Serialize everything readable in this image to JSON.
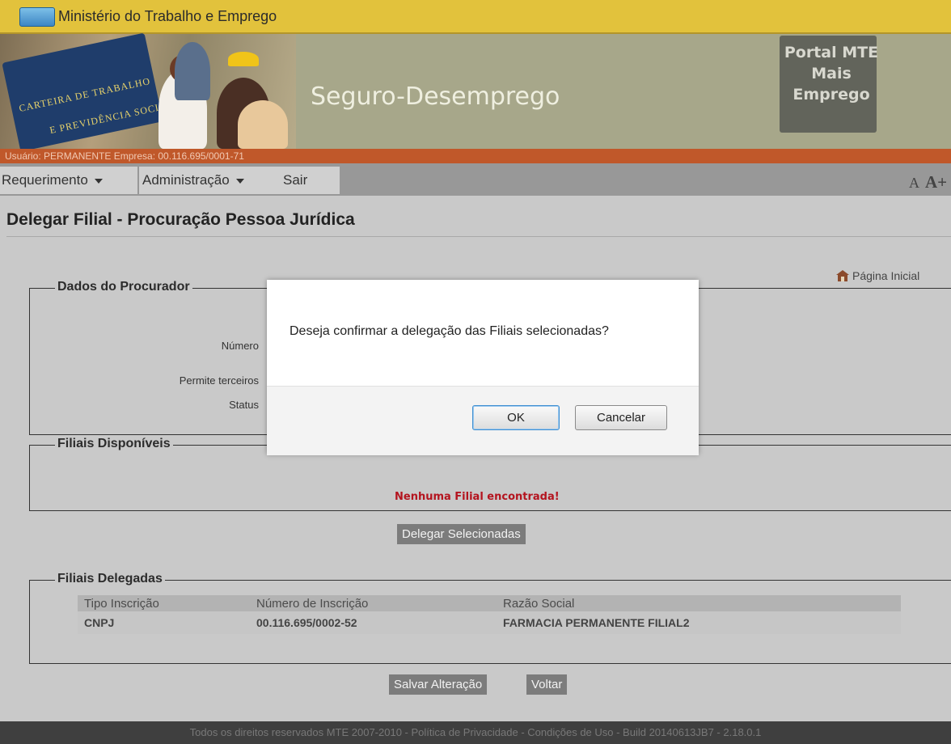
{
  "gov_bar": {
    "title": "Ministério do Trabalho e Emprego"
  },
  "header": {
    "card_line1": "CARTEIRA DE TRABALHO",
    "card_line2": "E PREVIDÊNCIA SOCIAL",
    "site_title": "Seguro-Desemprego",
    "portal_line1": "Portal MTE",
    "portal_line2": "Mais",
    "portal_line3": "Emprego"
  },
  "user_bar": {
    "text": "Usuário: PERMANENTE Empresa: 00.116.695/0001-71"
  },
  "menu": {
    "items": [
      {
        "label": "Requerimento",
        "has_dropdown": true
      },
      {
        "label": "Administração",
        "has_dropdown": true
      },
      {
        "label": "Sair",
        "has_dropdown": false
      }
    ],
    "font_small": "A",
    "font_large": "A+"
  },
  "page": {
    "title": "Delegar Filial - Procuração Pessoa Jurídica",
    "home_link": "Página Inicial"
  },
  "procurador": {
    "legend": "Dados do Procurador",
    "label_numero": "Número",
    "label_permite": "Permite terceiros",
    "label_status": "Status"
  },
  "disponiveis": {
    "legend": "Filiais Disponíveis",
    "empty_message": "Nenhuma Filial encontrada!",
    "delegate_button": "Delegar Selecionadas"
  },
  "delegadas": {
    "legend": "Filiais Delegadas",
    "columns": [
      "Tipo Inscrição",
      "Número de Inscrição",
      "Razão Social"
    ],
    "rows": [
      {
        "tipo": "CNPJ",
        "numero": "00.116.695/0002-52",
        "razao": "FARMACIA PERMANENTE FILIAL2"
      }
    ]
  },
  "actions": {
    "save": "Salvar Alteração",
    "back": "Voltar"
  },
  "footer": {
    "text": "Todos os direitos reservados MTE 2007-2010 - Política de Privacidade - Condições de Uso - Build 20140613JB7 - 2.18.0.1"
  },
  "dialog": {
    "message": "Deseja confirmar a delegação das Filiais selecionadas?",
    "ok": "OK",
    "cancel": "Cancelar"
  },
  "colors": {
    "gov_bar": "#e2c23c",
    "header": "#a7a78a",
    "user_bar": "#c0582a",
    "error_text": "#b4141f"
  }
}
